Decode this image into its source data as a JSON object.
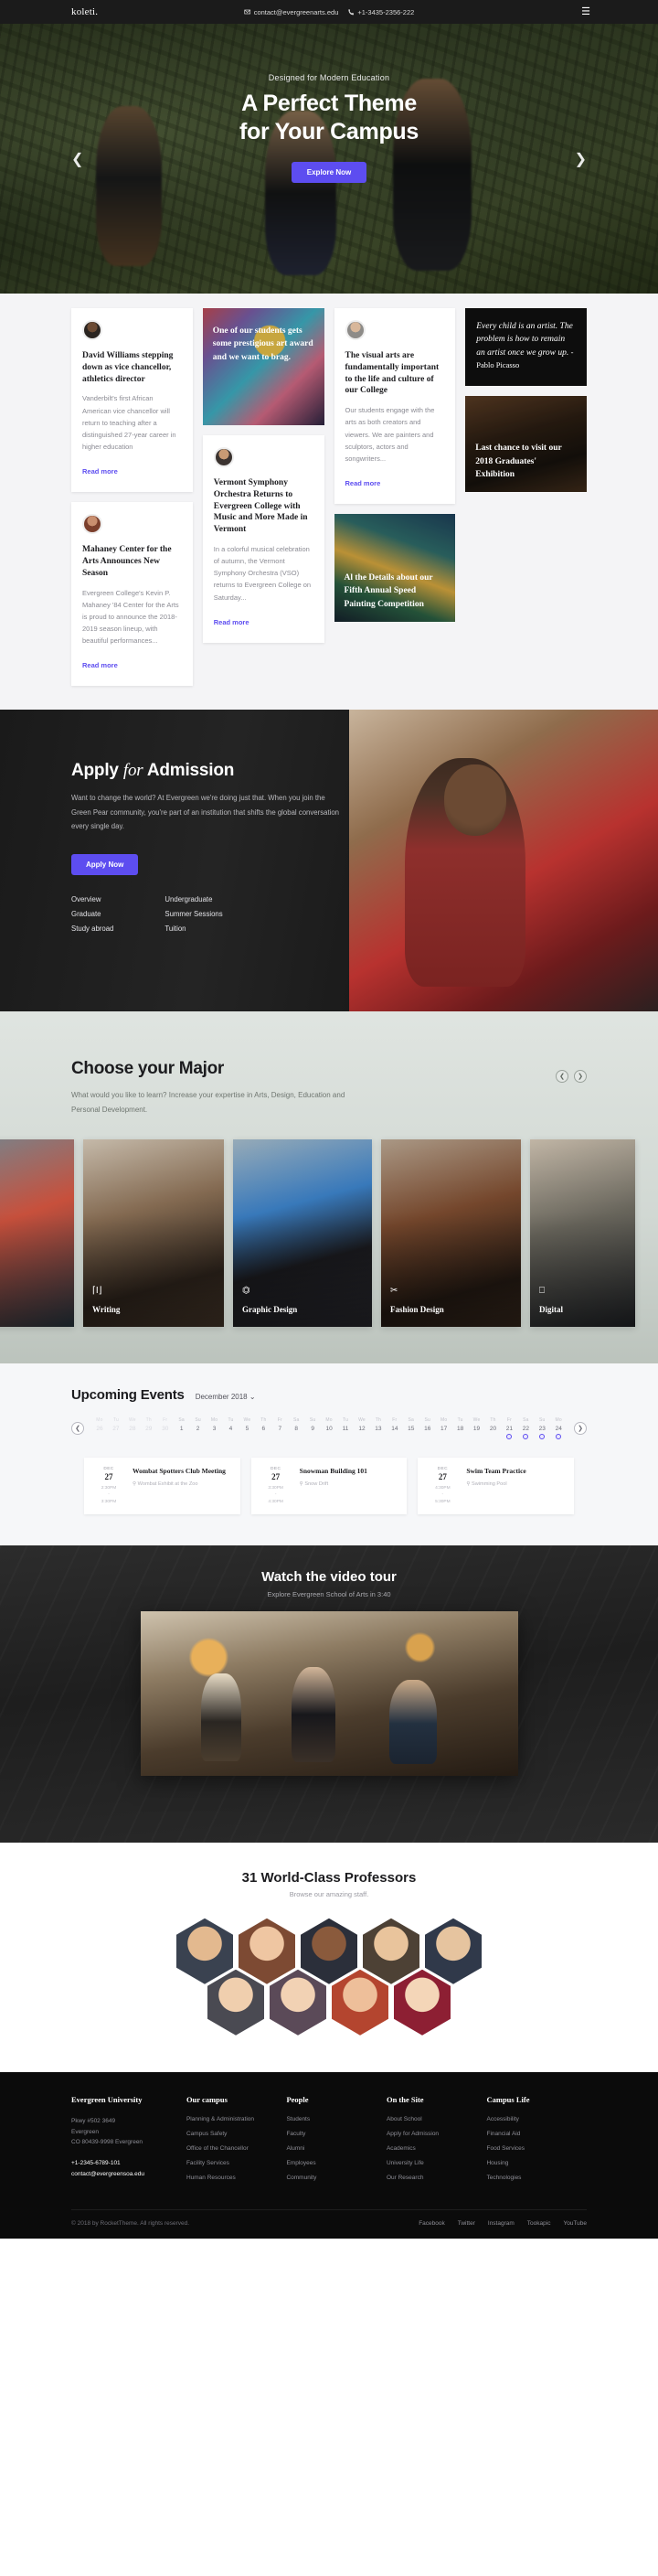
{
  "topbar": {
    "logo": "koleti.",
    "email": "contact@evergreenarts.edu",
    "phone": "+1-3435-2356-222",
    "email_icon": "envelope-icon",
    "phone_icon": "phone-icon",
    "menu_icon": "hamburger-menu-icon"
  },
  "hero": {
    "kicker": "Designed for Modern Education",
    "title_line1": "A Perfect Theme",
    "title_line2": "for Your Campus",
    "cta": "Explore Now",
    "prev_icon": "chevron-left-icon",
    "next_icon": "chevron-right-icon",
    "accent": "#5d4df0"
  },
  "news": {
    "read_more": "Read more",
    "col1": [
      {
        "type": "article",
        "title": "David Williams stepping down as vice chancellor, athletics director",
        "excerpt": "Vanderbilt's first African American vice chancellor will return to teaching after a distinguished 27-year career in higher education"
      },
      {
        "type": "article",
        "title": "Mahaney Center for the Arts Announces New Season",
        "excerpt": "Evergreen College's Kevin P. Mahaney '84 Center for the Arts is proud to announce the 2018-2019 season lineup, with beautiful performances..."
      }
    ],
    "col2": [
      {
        "type": "image",
        "title": "One of our students gets some prestigious art award and we want to brag."
      },
      {
        "type": "article",
        "title": "Vermont Symphony Orchestra Returns to Evergreen College with Music and More Made in Vermont",
        "excerpt": "In a colorful musical celebration of autumn, the Vermont Symphony Orchestra (VSO) returns to Evergreen College on Saturday..."
      }
    ],
    "col3": [
      {
        "type": "article",
        "title": "The visual arts are fundamentally important to the life and culture of our College",
        "excerpt": "Our students engage with the arts as both creators and viewers. We are painters and sculptors, actors and songwriters..."
      },
      {
        "type": "image",
        "title": "Al the Details about our Fifth Annual Speed Painting Competition"
      }
    ],
    "col4": [
      {
        "type": "quote",
        "text": "Every child is an artist. The problem is how to remain an artist once we grow up.",
        "source": "- Pablo Picasso"
      },
      {
        "type": "image",
        "title": "Last chance to visit our 2018 Graduates' Exhibition"
      }
    ]
  },
  "admission": {
    "title_a": "Apply",
    "title_b": "for",
    "title_c": "Admission",
    "body": "Want to change the world? At Evergreen we're doing just that. When you join the Green Pear community, you're part of an institution that shifts the global conversation every single day.",
    "cta": "Apply Now",
    "links_left": [
      "Overview",
      "Graduate",
      "Study abroad"
    ],
    "links_right": [
      "Undergraduate",
      "Summer Sessions",
      "Tuition"
    ]
  },
  "majors": {
    "title": "Choose your Major",
    "subtitle": "What would you like to learn? Increase your expertise in Arts, Design, Education and Personal Development.",
    "prev_icon": "chevron-left-icon",
    "next_icon": "chevron-right-icon",
    "items": [
      {
        "label": "",
        "icon": ""
      },
      {
        "label": "Writing",
        "icon": "text-cursor-icon",
        "glyph": "I"
      },
      {
        "label": "Graphic Design",
        "icon": "crop-icon",
        "glyph": "⌗"
      },
      {
        "label": "Fashion Design",
        "icon": "scissors-icon",
        "glyph": "✂"
      },
      {
        "label": "Digital",
        "icon": "monitor-icon",
        "glyph": "🖵"
      }
    ]
  },
  "events": {
    "title": "Upcoming Events",
    "month_selector": "December 2018",
    "chevron_down_icon": "chevron-down-icon",
    "prev_icon": "chevron-left-icon",
    "next_icon": "chevron-right-icon",
    "calendar": [
      {
        "dn": "Mo",
        "dd": "26",
        "muted": true,
        "dot": false
      },
      {
        "dn": "Tu",
        "dd": "27",
        "muted": true,
        "dot": false
      },
      {
        "dn": "We",
        "dd": "28",
        "muted": true,
        "dot": false
      },
      {
        "dn": "Th",
        "dd": "29",
        "muted": true,
        "dot": false
      },
      {
        "dn": "Fr",
        "dd": "30",
        "muted": true,
        "dot": false
      },
      {
        "dn": "Sa",
        "dd": "1",
        "muted": false,
        "dot": false
      },
      {
        "dn": "Su",
        "dd": "2",
        "muted": false,
        "dot": false
      },
      {
        "dn": "Mo",
        "dd": "3",
        "muted": false,
        "dot": false
      },
      {
        "dn": "Tu",
        "dd": "4",
        "muted": false,
        "dot": false
      },
      {
        "dn": "We",
        "dd": "5",
        "muted": false,
        "dot": false
      },
      {
        "dn": "Th",
        "dd": "6",
        "muted": false,
        "dot": false
      },
      {
        "dn": "Fr",
        "dd": "7",
        "muted": false,
        "dot": false
      },
      {
        "dn": "Sa",
        "dd": "8",
        "muted": false,
        "dot": false
      },
      {
        "dn": "Su",
        "dd": "9",
        "muted": false,
        "dot": false
      },
      {
        "dn": "Mo",
        "dd": "10",
        "muted": false,
        "dot": false
      },
      {
        "dn": "Tu",
        "dd": "11",
        "muted": false,
        "dot": false
      },
      {
        "dn": "We",
        "dd": "12",
        "muted": false,
        "dot": false
      },
      {
        "dn": "Th",
        "dd": "13",
        "muted": false,
        "dot": false
      },
      {
        "dn": "Fr",
        "dd": "14",
        "muted": false,
        "dot": false
      },
      {
        "dn": "Sa",
        "dd": "15",
        "muted": false,
        "dot": false
      },
      {
        "dn": "Su",
        "dd": "16",
        "muted": false,
        "dot": false
      },
      {
        "dn": "Mo",
        "dd": "17",
        "muted": false,
        "dot": false
      },
      {
        "dn": "Tu",
        "dd": "18",
        "muted": false,
        "dot": false
      },
      {
        "dn": "We",
        "dd": "19",
        "muted": false,
        "dot": false
      },
      {
        "dn": "Th",
        "dd": "20",
        "muted": false,
        "dot": false
      },
      {
        "dn": "Fr",
        "dd": "21",
        "muted": false,
        "dot": true
      },
      {
        "dn": "Sa",
        "dd": "22",
        "muted": false,
        "dot": true
      },
      {
        "dn": "Su",
        "dd": "23",
        "muted": false,
        "dot": true
      },
      {
        "dn": "Mo",
        "dd": "24",
        "muted": false,
        "dot": true
      }
    ],
    "cards": [
      {
        "month": "DEC",
        "day": "27",
        "start": "2:30PM",
        "end": "3:30PM",
        "title": "Wombat Spotters Club Meeting",
        "location": "Wombat Exhibit at the Zoo",
        "pin_icon": "map-pin-icon"
      },
      {
        "month": "DEC",
        "day": "27",
        "start": "3:30PM",
        "end": "4:30PM",
        "title": "Snowman Building 101",
        "location": "Snow Drift",
        "pin_icon": "map-pin-icon"
      },
      {
        "month": "DEC",
        "day": "27",
        "start": "4:30PM",
        "end": "5:30PM",
        "title": "Swim Team Practice",
        "location": "Swimming Pool",
        "pin_icon": "map-pin-icon"
      }
    ]
  },
  "video": {
    "title": "Watch the video tour",
    "subtitle": "Explore Evergreen School of Arts in 3:40"
  },
  "professors": {
    "title": "31 World-Class Professors",
    "subtitle": "Browse our amazing staff.",
    "row1_count": 5,
    "row2_count": 4
  },
  "footer": {
    "brand": "Evergreen University",
    "address_lines": [
      "Pkwy #502 3649",
      "Evergreen",
      "CO 80439-9998 Evergreen"
    ],
    "phone": "+1-2345-6789-101",
    "email": "contact@evergreensoa.edu",
    "columns": [
      {
        "heading": "Our campus",
        "links": [
          "Planning & Administration",
          "Campus Safety",
          "Office of the Chancellor",
          "Facility Services",
          "Human Resources"
        ]
      },
      {
        "heading": "People",
        "links": [
          "Students",
          "Faculty",
          "Alumni",
          "Employees",
          "Community"
        ]
      },
      {
        "heading": "On the Site",
        "links": [
          "About School",
          "Apply for Admission",
          "Academics",
          "University Life",
          "Our Research"
        ]
      },
      {
        "heading": "Campus Life",
        "links": [
          "Accessibility",
          "Financial Aid",
          "Food Services",
          "Housing",
          "Technologies"
        ]
      }
    ],
    "copyright": "© 2018 by RocketTheme. All rights reserved.",
    "social": [
      "Facebook",
      "Twitter",
      "Instagram",
      "Tookapic",
      "YouTube"
    ]
  }
}
